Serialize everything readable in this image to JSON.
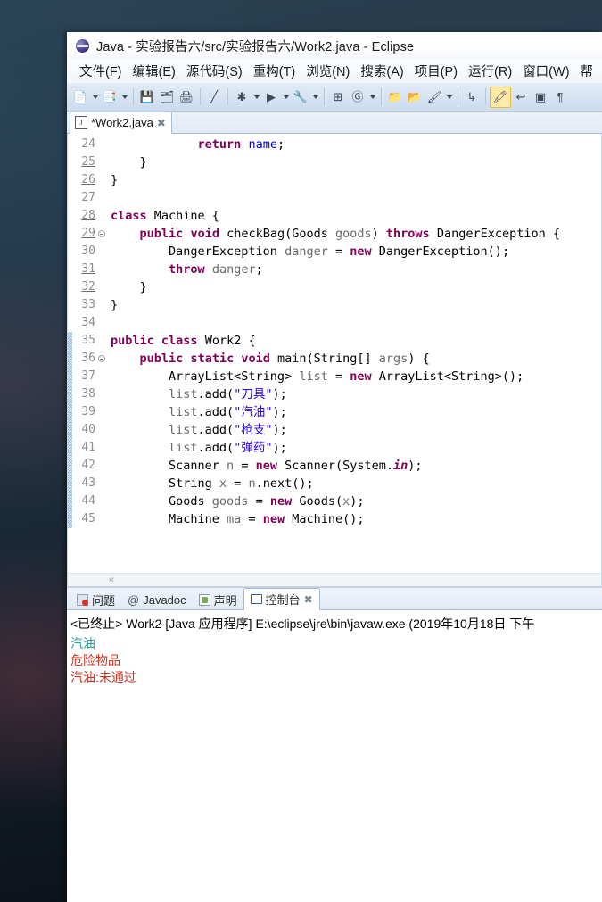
{
  "window": {
    "title": "Java - 实验报告六/src/实验报告六/Work2.java - Eclipse",
    "logo_icon": "eclipse-logo-icon"
  },
  "menu": {
    "items": [
      {
        "label": "文件(F)"
      },
      {
        "label": "编辑(E)"
      },
      {
        "label": "源代码(S)"
      },
      {
        "label": "重构(T)"
      },
      {
        "label": "浏览(N)"
      },
      {
        "label": "搜索(A)"
      },
      {
        "label": "项目(P)"
      },
      {
        "label": "运行(R)"
      },
      {
        "label": "窗口(W)"
      },
      {
        "label": "帮"
      }
    ]
  },
  "toolbar": {
    "buttons": [
      {
        "icon": "new-file-icon",
        "glyph": "📄",
        "dropdown": true
      },
      {
        "icon": "new-java-class-icon",
        "glyph": "📑",
        "dropdown": true
      },
      {
        "icon": "save-icon",
        "glyph": "💾",
        "dropdown": false
      },
      {
        "icon": "save-all-icon",
        "glyph": "🗂",
        "dropdown": false
      },
      {
        "icon": "print-icon",
        "glyph": "🖨",
        "dropdown": false
      },
      {
        "icon": "toggle-mark-occurrences-icon",
        "glyph": "╱",
        "dropdown": false
      },
      {
        "icon": "debug-icon",
        "glyph": "✱",
        "dropdown": true
      },
      {
        "icon": "run-icon",
        "glyph": "▶",
        "dropdown": true
      },
      {
        "icon": "external-tools-icon",
        "glyph": "🔧",
        "dropdown": true
      },
      {
        "icon": "new-java-project-icon",
        "glyph": "⊞",
        "dropdown": false
      },
      {
        "icon": "open-type-icon",
        "glyph": "Ⓖ",
        "dropdown": true
      },
      {
        "icon": "search-folder-icon",
        "glyph": "📁",
        "dropdown": false
      },
      {
        "icon": "open-resource-icon",
        "glyph": "📂",
        "dropdown": false
      },
      {
        "icon": "quick-fix-icon",
        "glyph": "🖌",
        "dropdown": true
      },
      {
        "icon": "next-annotation-icon",
        "glyph": "↳",
        "dropdown": false
      },
      {
        "icon": "highlight-icon",
        "glyph": "🖍",
        "dropdown": false,
        "active": true
      },
      {
        "icon": "previous-edit-icon",
        "glyph": "↩",
        "dropdown": false
      },
      {
        "icon": "restore-view-icon",
        "glyph": "▣",
        "dropdown": false
      },
      {
        "icon": "pilcrow-icon",
        "glyph": "¶",
        "dropdown": false
      }
    ]
  },
  "editor": {
    "tab": {
      "label": "*Work2.java",
      "file_icon": "java-file-icon",
      "file_icon_letter": "J",
      "close_icon": "close-icon",
      "close_glyph": "✖"
    },
    "first_line_number": 24,
    "lines": [
      {
        "num": 24,
        "modified": false,
        "fold": false,
        "diff": false,
        "html": "            <span class=\"kw\">return</span> <span class=\"fld\">name</span>;"
      },
      {
        "num": 25,
        "modified": true,
        "fold": false,
        "diff": false,
        "html": "    }"
      },
      {
        "num": 26,
        "modified": true,
        "fold": false,
        "diff": false,
        "html": "}"
      },
      {
        "num": 27,
        "modified": false,
        "fold": false,
        "diff": false,
        "html": ""
      },
      {
        "num": 28,
        "modified": true,
        "fold": false,
        "diff": false,
        "html": "<span class=\"kw\">class</span> Machine {"
      },
      {
        "num": 29,
        "modified": true,
        "fold": true,
        "diff": false,
        "html": "    <span class=\"kw\">public</span> <span class=\"kw\">void</span> checkBag(Goods <span class=\"loc\">goods</span>) <span class=\"kw\">throws</span> DangerException {"
      },
      {
        "num": 30,
        "modified": false,
        "fold": false,
        "diff": false,
        "html": "        DangerException <span class=\"loc\">danger</span> = <span class=\"kw\">new</span> DangerException();"
      },
      {
        "num": 31,
        "modified": true,
        "fold": false,
        "diff": false,
        "html": "        <span class=\"kw\">throw</span> <span class=\"loc\">danger</span>;"
      },
      {
        "num": 32,
        "modified": true,
        "fold": false,
        "diff": false,
        "html": "    }"
      },
      {
        "num": 33,
        "modified": false,
        "fold": false,
        "diff": false,
        "html": "}"
      },
      {
        "num": 34,
        "modified": false,
        "fold": false,
        "diff": false,
        "html": ""
      },
      {
        "num": 35,
        "modified": false,
        "fold": false,
        "diff": true,
        "html": "<span class=\"kw\">public</span> <span class=\"kw\">class</span> Work2 {"
      },
      {
        "num": 36,
        "modified": false,
        "fold": true,
        "diff": true,
        "html": "    <span class=\"kw\">public</span> <span class=\"kw\">static</span> <span class=\"kw\">void</span> main(String[] <span class=\"loc\">args</span>) {"
      },
      {
        "num": 37,
        "modified": false,
        "fold": false,
        "diff": true,
        "html": "        ArrayList&lt;String&gt; <span class=\"loc\">list</span> = <span class=\"kw\">new</span> ArrayList&lt;String&gt;();"
      },
      {
        "num": 38,
        "modified": false,
        "fold": false,
        "diff": true,
        "html": "        <span class=\"loc\">list</span>.add(<span class=\"str\">\"刀具\"</span>);"
      },
      {
        "num": 39,
        "modified": false,
        "fold": false,
        "diff": true,
        "html": "        <span class=\"loc\">list</span>.add(<span class=\"str\">\"汽油\"</span>);"
      },
      {
        "num": 40,
        "modified": false,
        "fold": false,
        "diff": true,
        "html": "        <span class=\"loc\">list</span>.add(<span class=\"str\">\"枪支\"</span>);"
      },
      {
        "num": 41,
        "modified": false,
        "fold": false,
        "diff": true,
        "html": "        <span class=\"loc\">list</span>.add(<span class=\"str\">\"弹药\"</span>);"
      },
      {
        "num": 42,
        "modified": false,
        "fold": false,
        "diff": true,
        "html": "        Scanner <span class=\"loc\">n</span> = <span class=\"kw\">new</span> Scanner(System.<span class=\"kwi\">in</span>);"
      },
      {
        "num": 43,
        "modified": false,
        "fold": false,
        "diff": true,
        "html": "        String <span class=\"loc\">x</span> = <span class=\"loc\">n</span>.next();"
      },
      {
        "num": 44,
        "modified": false,
        "fold": false,
        "diff": true,
        "html": "        Goods <span class=\"loc\">goods</span> = <span class=\"kw\">new</span> Goods(<span class=\"loc\">x</span>);"
      },
      {
        "num": 45,
        "modified": false,
        "fold": false,
        "diff": true,
        "html": "        Machine <span class=\"loc\">ma</span> = <span class=\"kw\">new</span> Machine();"
      }
    ],
    "hscroll_left_glyph": "«"
  },
  "bottom_panel": {
    "tabs": [
      {
        "label": "问题",
        "icon": "problems-icon",
        "active": false
      },
      {
        "label": "Javadoc",
        "icon": "javadoc-icon",
        "active": false
      },
      {
        "label": "声明",
        "icon": "declaration-icon",
        "active": false
      },
      {
        "label": "控制台",
        "icon": "console-icon",
        "active": true
      }
    ],
    "close_glyph": "✖",
    "console": {
      "header": "<已终止> Work2 [Java 应用程序] E:\\eclipse\\jre\\bin\\javaw.exe  (2019年10月18日 下午",
      "output": [
        {
          "text": "汽油",
          "color": "#2aa198"
        },
        {
          "text": "危险物品",
          "color": "#cc3322"
        },
        {
          "text": "汽油:未通过",
          "color": "#cc3322"
        }
      ]
    }
  }
}
